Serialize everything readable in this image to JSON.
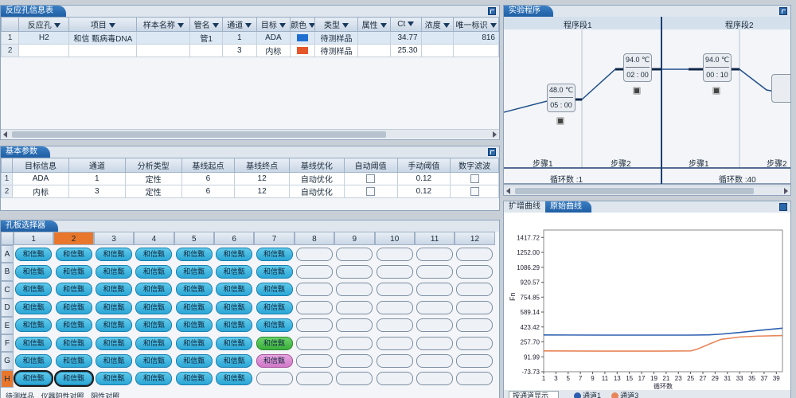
{
  "reaction_panel": {
    "title": "反应孔信息表",
    "columns": [
      "反应孔",
      "项目",
      "样本名称",
      "管名",
      "通道",
      "目标",
      "颜色",
      "类型",
      "属性",
      "Ct",
      "浓度",
      "唯一标识"
    ],
    "rows": [
      {
        "n": "1",
        "well": "H2",
        "item": "和信 甄病毒DNA",
        "sample": "",
        "tube": "管1",
        "channel": "1",
        "target": "ADA",
        "color": "#1f6fd1",
        "type": "待测样品",
        "attr": "",
        "ct": "34.77",
        "conc": "",
        "uid": "816"
      },
      {
        "n": "2",
        "well": "",
        "item": "",
        "sample": "",
        "tube": "",
        "channel": "3",
        "target": "内标",
        "color": "#e5562a",
        "type": "待测样品",
        "attr": "",
        "ct": "25.30",
        "conc": "",
        "uid": ""
      }
    ]
  },
  "basic_params": {
    "title": "基本参数",
    "columns": [
      "目标信息",
      "通道",
      "分析类型",
      "基线起点",
      "基线终点",
      "基线优化",
      "自动阈值",
      "手动阈值",
      "数字滤波"
    ],
    "rows": [
      {
        "n": "1",
        "target": "ADA",
        "channel": "1",
        "analysis": "定性",
        "start": "6",
        "end": "12",
        "opt": "自动优化",
        "manual": "0.12"
      },
      {
        "n": "2",
        "target": "内标",
        "channel": "3",
        "analysis": "定性",
        "start": "6",
        "end": "12",
        "opt": "自动优化",
        "manual": "0.12"
      }
    ]
  },
  "plate": {
    "title": "孔板选择器",
    "columns": [
      "1",
      "2",
      "3",
      "4",
      "5",
      "6",
      "7",
      "8",
      "9",
      "10",
      "11",
      "12"
    ],
    "rows": [
      "A",
      "B",
      "C",
      "D",
      "E",
      "F",
      "G",
      "H"
    ],
    "highlight_col": "2",
    "highlight_row": "H",
    "well_label": "和信甄",
    "colors": {
      "filled": "#2aa6d6",
      "green": "#3aae3a",
      "pink": "#cf78c7",
      "empty": "#eef1f5"
    },
    "filled_counts": {
      "A": 7,
      "B": 7,
      "C": 7,
      "D": 7,
      "E": 7,
      "F": 6,
      "G": 6,
      "H": 6
    },
    "special": {
      "F7": "green",
      "G7": "pink"
    },
    "selected": [
      "H1",
      "H2"
    ],
    "legend": [
      "待测样品",
      "仪器阳性对照",
      "阴性对照"
    ]
  },
  "program": {
    "title": "实验程序",
    "segments": [
      "程序段1",
      "程序段2"
    ],
    "steps": [
      {
        "label": "步骤1",
        "temp": "48.0 ℃",
        "time": "05 : 00"
      },
      {
        "label": "步骤2",
        "temp": "94.0 ℃",
        "time": "02 : 00"
      },
      {
        "label": "步骤1",
        "temp": "94.0 ℃",
        "time": "00 : 10"
      },
      {
        "label": "步骤2",
        "temp": "",
        "time": ""
      }
    ],
    "cycles": [
      "循环数 :1",
      "循环数 :40"
    ]
  },
  "curves": {
    "tabs": [
      "扩增曲线",
      "原始曲线"
    ],
    "active_tab": "原始曲线",
    "footer": [
      "按通道显示",
      "通道1",
      "通道3"
    ]
  },
  "chart_data": {
    "type": "line",
    "ylabel": "Fn",
    "xlabel": "循环数",
    "yticks": [
      "1417.72",
      "1252.00",
      "1086.29",
      "920.57",
      "754.85",
      "589.14",
      "423.42",
      "257.70",
      "91.99",
      "-73.73"
    ],
    "xticks": [
      "1",
      "3",
      "5",
      "7",
      "9",
      "11",
      "13",
      "15",
      "17",
      "19",
      "21",
      "23",
      "25",
      "27",
      "29",
      "31",
      "33",
      "35",
      "37",
      "39"
    ],
    "ylim": [
      -73.73,
      1500
    ],
    "xlim": [
      1,
      40
    ],
    "series": [
      {
        "name": "通道1",
        "color": "#2d5fb0",
        "x": [
          1,
          5,
          10,
          15,
          20,
          25,
          28,
          30,
          33,
          36,
          40
        ],
        "values": [
          335,
          334,
          333,
          333,
          333,
          333,
          336,
          344,
          362,
          384,
          410
        ]
      },
      {
        "name": "通道3",
        "color": "#e8865a",
        "x": [
          1,
          5,
          10,
          15,
          20,
          25,
          26,
          28,
          30,
          33,
          36,
          40
        ],
        "values": [
          158,
          157,
          156,
          156,
          156,
          158,
          175,
          232,
          286,
          312,
          322,
          328
        ]
      }
    ]
  }
}
